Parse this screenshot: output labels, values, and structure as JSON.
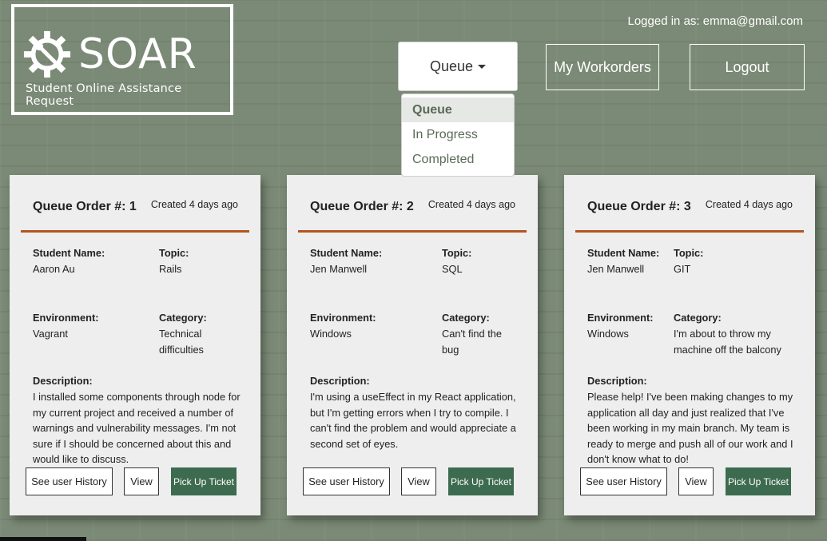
{
  "logo": {
    "title": "SOAR",
    "subtitle": "Student Online Assistance Request"
  },
  "header": {
    "logged_in": "Logged in as: emma@gmail.com",
    "dropdown_label": "Queue",
    "workorders_label": "My Workorders",
    "logout_label": "Logout"
  },
  "dropdown": {
    "items": [
      "Queue",
      "In Progress",
      "Completed"
    ],
    "active": "Queue"
  },
  "labels": {
    "student_name": "Student Name:",
    "topic": "Topic:",
    "environment": "Environment:",
    "category": "Category:",
    "description": "Description:",
    "history_btn": "See user History",
    "view_btn": "View",
    "pickup_btn": "Pick Up Ticket"
  },
  "cards": [
    {
      "title": "Queue Order #: 1",
      "created": "Created 4 days ago",
      "student": "Aaron Au",
      "topic": "Rails",
      "environment": "Vagrant",
      "category": "Technical difficulties",
      "description": "I installed some components through node for my current project and received a number of warnings and vulnerability messages. I'm not sure if I should be concerned about this and would like to discuss."
    },
    {
      "title": "Queue Order #: 2",
      "created": "Created 4 days ago",
      "student": "Jen Manwell",
      "topic": "SQL",
      "environment": "Windows",
      "category": "Can't find the bug",
      "description": "I'm using a useEffect in my React application, but I'm getting errors when I try to compile. I can't find the problem and would appreciate a second set of eyes."
    },
    {
      "title": "Queue Order #: 3",
      "created": "Created 4 days ago",
      "student": "Jen Manwell",
      "topic": "GIT",
      "environment": "Windows",
      "category": "I'm about to throw my machine off the balcony",
      "description": "Please help! I've been making changes to my application all day and just realized that I've been working in my main branch. My team is ready to merge and push all of our work and I don't know what to do!"
    }
  ]
}
